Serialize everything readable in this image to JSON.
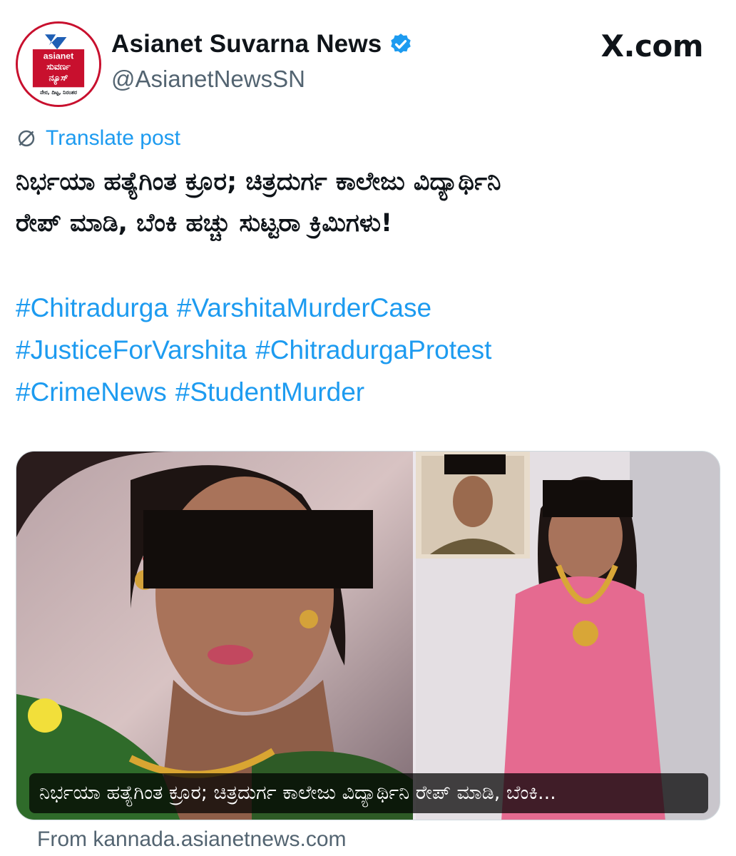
{
  "account": {
    "display_name": "Asianet Suvarna News",
    "handle": "@AsianetNewsSN",
    "verified": true,
    "avatar_brand_color": "#c8102e",
    "avatar_lines": [
      "asianet",
      "ಸುವರ್ಣ",
      "ನ್ಯೂಸ್",
      "ನೇರ, ದಿಟ್ಟ, ನಿರಂತರ"
    ]
  },
  "site_label": "X.com",
  "translate": {
    "label": "Translate post",
    "icon": "translate-icon"
  },
  "post": {
    "text_lines": [
      "ನಿರ್ಭಯಾ ಹತ್ಯೆಗಿಂತ ಕ್ರೂರ; ಚಿತ್ರದುರ್ಗ ಕಾಲೇಜು ವಿದ್ಯಾರ್ಥಿನಿ",
      "ರೇಪ್ ಮಾಡಿ, ಬೆಂಕಿ ಹಚ್ಚು ಸುಟ್ಟರಾ ಕ್ರಿಮಿಗಳು!"
    ],
    "hashtags": [
      "#Chitradurga",
      "#VarshitaMurderCase",
      "#JusticeForVarshita",
      "#ChitradurgaProtest",
      "#CrimeNews",
      "#StudentMurder"
    ]
  },
  "media": {
    "caption": "ನಿರ್ಭಯಾ ಹತ್ಯೆಗಿಂತ ಕ್ರೂರ; ಚಿತ್ರದುರ್ಗ ಕಾಲೇಜು ವಿದ್ಯಾರ್ಥಿನಿ ರೇಪ್ ಮಾಡಿ, ಬೆಂಕಿ...",
    "source": "From kannada.asianetnews.com"
  },
  "colors": {
    "link": "#1d9bf0",
    "muted": "#536471",
    "text": "#0f1419"
  }
}
